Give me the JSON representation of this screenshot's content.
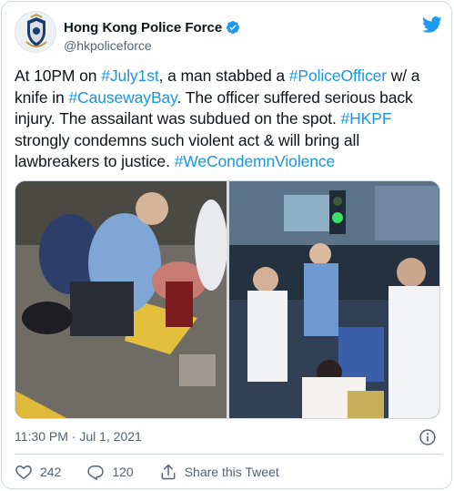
{
  "author": {
    "name": "Hong Kong Police Force",
    "handle": "@hkpoliceforce",
    "avatar_icon": "police-crest-icon",
    "verified_icon": "verified-badge-icon"
  },
  "brand_icon": "twitter-bird-icon",
  "tweet": {
    "segments": [
      {
        "text": "At 10PM on ",
        "tag": false
      },
      {
        "text": "#July1st",
        "tag": true
      },
      {
        "text": ", a man stabbed a ",
        "tag": false
      },
      {
        "text": "#PoliceOfficer",
        "tag": true
      },
      {
        "text": " w/ a knife in ",
        "tag": false
      },
      {
        "text": "#CausewayBay",
        "tag": true
      },
      {
        "text": ". The officer suffered serious back injury. The assailant was subdued on the spot. ",
        "tag": false
      },
      {
        "text": "#HKPF",
        "tag": true
      },
      {
        "text": " strongly condemns such violent act & will bring all lawbreakers to justice. ",
        "tag": false
      },
      {
        "text": "#WeCondemnViolence",
        "tag": true
      }
    ]
  },
  "media": {
    "photos": [
      {
        "name": "photo-officer-injured"
      },
      {
        "name": "photo-street-scene"
      }
    ]
  },
  "meta": {
    "timestamp": "11:30 PM · Jul 1, 2021",
    "info_icon": "info-icon"
  },
  "actions": {
    "like_count": "242",
    "reply_count": "120",
    "share_label": "Share this Tweet"
  },
  "colors": {
    "link": "#1b95e0",
    "verified": "#1d9bf0",
    "secondary_text": "#536471",
    "border": "#cfd9de"
  }
}
